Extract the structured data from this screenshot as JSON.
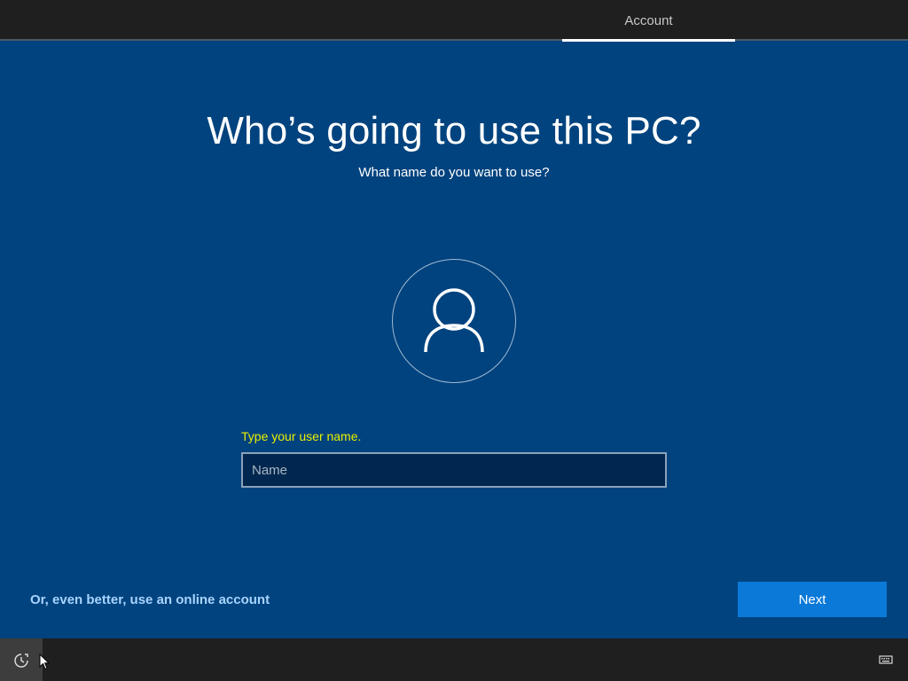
{
  "topbar": {
    "active_tab": "Account"
  },
  "main": {
    "title": "Who’s going to use this PC?",
    "subtitle": "What name do you want to use?",
    "avatar_icon": "user-icon",
    "name_field": {
      "label": "Type your user name.",
      "placeholder": "Name",
      "value": ""
    },
    "online_account_link": "Or, even better, use an online account",
    "next_label": "Next"
  },
  "bottombar": {
    "ease_of_access_icon": "ease-of-access-icon",
    "keyboard_icon": "keyboard-icon"
  },
  "colors": {
    "background": "#00437e",
    "bar": "#1f1f1f",
    "accent_button": "#0a79d8",
    "label_yellow": "#e8f000",
    "link": "#a8d4ff"
  }
}
